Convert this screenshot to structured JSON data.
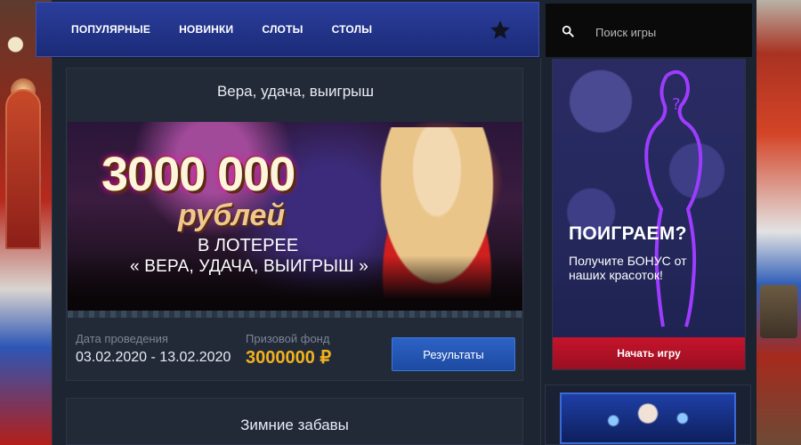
{
  "nav": {
    "items": [
      {
        "label": "ПОПУЛЯРНЫЕ"
      },
      {
        "label": "НОВИНКИ"
      },
      {
        "label": "СЛОТЫ"
      },
      {
        "label": "СТОЛЫ"
      }
    ],
    "favorites_icon": "star-icon"
  },
  "search": {
    "placeholder": "Поиск игры",
    "icon": "search-icon"
  },
  "promo": {
    "title": "Вера, удача, выигрыш",
    "banner": {
      "amount": "3000 000",
      "currency_word": "рублей",
      "line1": "В ЛОТЕРЕЕ",
      "line2": "« ВЕРА, УДАЧА, ВЫИГРЫШ »"
    },
    "date_label": "Дата проведения",
    "date_value": "03.02.2020 - 13.02.2020",
    "prize_label": "Призовой фонд",
    "prize_value": "3000000 ₽",
    "results_button": "Результаты"
  },
  "second_promo": {
    "title": "Зимние забавы"
  },
  "sidebar_ad": {
    "heading": "ПОИГРАЕМ?",
    "text": "Получите БОНУС от наших красоток!",
    "button": "Начать игру"
  },
  "colors": {
    "nav_bg": "#2b3e9c",
    "prize": "#f3b21d",
    "results_button": "#2c62c6",
    "ad_button": "#c5142b"
  }
}
